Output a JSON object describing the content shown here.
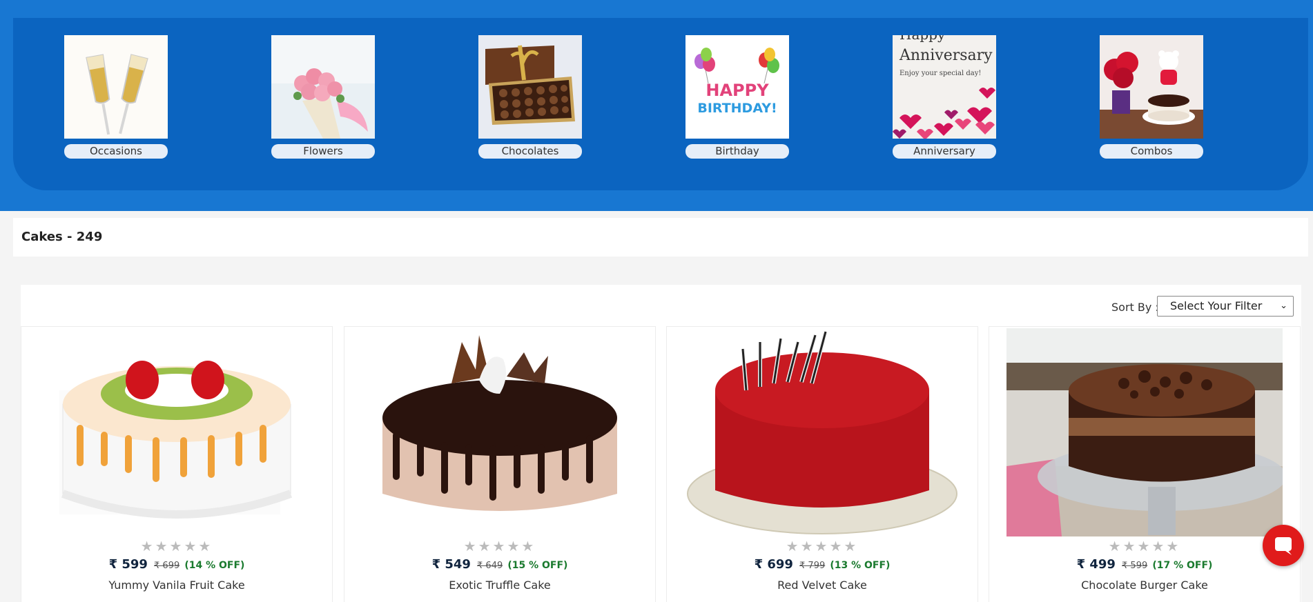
{
  "categories": [
    {
      "label": "Occasions",
      "icon": "champagne-glasses-image"
    },
    {
      "label": "Flowers",
      "icon": "rose-bouquet-image"
    },
    {
      "label": "Chocolates",
      "icon": "chocolate-box-image"
    },
    {
      "label": "Birthday",
      "icon": "happy-birthday-balloons-image",
      "art_text": "HAPPY BIRTHDAY!"
    },
    {
      "label": "Anniversary",
      "icon": "anniversary-card-image",
      "art_line1": "Happy",
      "art_line2": "Anniversary",
      "art_line3": "Enjoy your special day!"
    },
    {
      "label": "Combos",
      "icon": "teddy-cake-flowers-image"
    }
  ],
  "listing": {
    "title": "Cakes - 249"
  },
  "sort": {
    "label": "Sort By :",
    "selected": "Select Your Filter"
  },
  "products": [
    {
      "name": "Yummy Vanila Fruit Cake",
      "price": "₹ 599",
      "mrp": "₹ 699",
      "discount": "(14 % OFF)",
      "rating": 0,
      "image": "vanilla-fruit-cake-image"
    },
    {
      "name": "Exotic Truffle Cake",
      "price": "₹ 549",
      "mrp": "₹ 649",
      "discount": "(15 % OFF)",
      "rating": 0,
      "image": "truffle-cake-image"
    },
    {
      "name": "Red Velvet Cake",
      "price": "₹ 699",
      "mrp": "₹ 799",
      "discount": "(13 % OFF)",
      "rating": 0,
      "image": "red-velvet-cake-image"
    },
    {
      "name": "Chocolate Burger Cake",
      "price": "₹ 499",
      "mrp": "₹ 599",
      "discount": "(17 % OFF)",
      "rating": 0,
      "image": "chocolate-burger-cake-image"
    }
  ],
  "stars_glyph": "★★★★★",
  "colors": {
    "brand_blue": "#1877d2",
    "panel_blue": "#0b64c0",
    "chat_red": "#e01b1b",
    "discount_green": "#1a7a2e"
  }
}
